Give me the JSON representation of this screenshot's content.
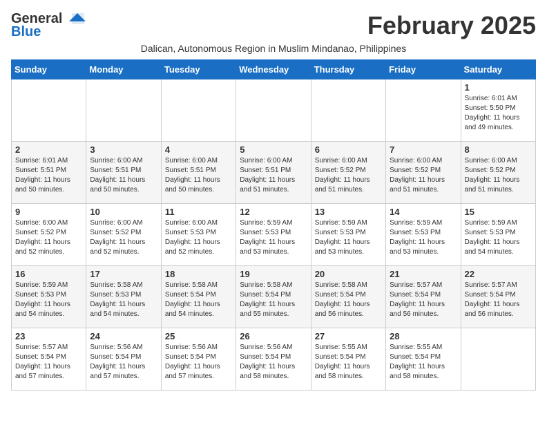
{
  "header": {
    "logo_general": "General",
    "logo_blue": "Blue",
    "month_title": "February 2025",
    "location": "Dalican, Autonomous Region in Muslim Mindanao, Philippines"
  },
  "days_of_week": [
    "Sunday",
    "Monday",
    "Tuesday",
    "Wednesday",
    "Thursday",
    "Friday",
    "Saturday"
  ],
  "weeks": [
    [
      {
        "day": "",
        "info": ""
      },
      {
        "day": "",
        "info": ""
      },
      {
        "day": "",
        "info": ""
      },
      {
        "day": "",
        "info": ""
      },
      {
        "day": "",
        "info": ""
      },
      {
        "day": "",
        "info": ""
      },
      {
        "day": "1",
        "info": "Sunrise: 6:01 AM\nSunset: 5:50 PM\nDaylight: 11 hours\nand 49 minutes."
      }
    ],
    [
      {
        "day": "2",
        "info": "Sunrise: 6:01 AM\nSunset: 5:51 PM\nDaylight: 11 hours\nand 50 minutes."
      },
      {
        "day": "3",
        "info": "Sunrise: 6:00 AM\nSunset: 5:51 PM\nDaylight: 11 hours\nand 50 minutes."
      },
      {
        "day": "4",
        "info": "Sunrise: 6:00 AM\nSunset: 5:51 PM\nDaylight: 11 hours\nand 50 minutes."
      },
      {
        "day": "5",
        "info": "Sunrise: 6:00 AM\nSunset: 5:51 PM\nDaylight: 11 hours\nand 51 minutes."
      },
      {
        "day": "6",
        "info": "Sunrise: 6:00 AM\nSunset: 5:52 PM\nDaylight: 11 hours\nand 51 minutes."
      },
      {
        "day": "7",
        "info": "Sunrise: 6:00 AM\nSunset: 5:52 PM\nDaylight: 11 hours\nand 51 minutes."
      },
      {
        "day": "8",
        "info": "Sunrise: 6:00 AM\nSunset: 5:52 PM\nDaylight: 11 hours\nand 51 minutes."
      }
    ],
    [
      {
        "day": "9",
        "info": "Sunrise: 6:00 AM\nSunset: 5:52 PM\nDaylight: 11 hours\nand 52 minutes."
      },
      {
        "day": "10",
        "info": "Sunrise: 6:00 AM\nSunset: 5:52 PM\nDaylight: 11 hours\nand 52 minutes."
      },
      {
        "day": "11",
        "info": "Sunrise: 6:00 AM\nSunset: 5:53 PM\nDaylight: 11 hours\nand 52 minutes."
      },
      {
        "day": "12",
        "info": "Sunrise: 5:59 AM\nSunset: 5:53 PM\nDaylight: 11 hours\nand 53 minutes."
      },
      {
        "day": "13",
        "info": "Sunrise: 5:59 AM\nSunset: 5:53 PM\nDaylight: 11 hours\nand 53 minutes."
      },
      {
        "day": "14",
        "info": "Sunrise: 5:59 AM\nSunset: 5:53 PM\nDaylight: 11 hours\nand 53 minutes."
      },
      {
        "day": "15",
        "info": "Sunrise: 5:59 AM\nSunset: 5:53 PM\nDaylight: 11 hours\nand 54 minutes."
      }
    ],
    [
      {
        "day": "16",
        "info": "Sunrise: 5:59 AM\nSunset: 5:53 PM\nDaylight: 11 hours\nand 54 minutes."
      },
      {
        "day": "17",
        "info": "Sunrise: 5:58 AM\nSunset: 5:53 PM\nDaylight: 11 hours\nand 54 minutes."
      },
      {
        "day": "18",
        "info": "Sunrise: 5:58 AM\nSunset: 5:54 PM\nDaylight: 11 hours\nand 54 minutes."
      },
      {
        "day": "19",
        "info": "Sunrise: 5:58 AM\nSunset: 5:54 PM\nDaylight: 11 hours\nand 55 minutes."
      },
      {
        "day": "20",
        "info": "Sunrise: 5:58 AM\nSunset: 5:54 PM\nDaylight: 11 hours\nand 56 minutes."
      },
      {
        "day": "21",
        "info": "Sunrise: 5:57 AM\nSunset: 5:54 PM\nDaylight: 11 hours\nand 56 minutes."
      },
      {
        "day": "22",
        "info": "Sunrise: 5:57 AM\nSunset: 5:54 PM\nDaylight: 11 hours\nand 56 minutes."
      }
    ],
    [
      {
        "day": "23",
        "info": "Sunrise: 5:57 AM\nSunset: 5:54 PM\nDaylight: 11 hours\nand 57 minutes."
      },
      {
        "day": "24",
        "info": "Sunrise: 5:56 AM\nSunset: 5:54 PM\nDaylight: 11 hours\nand 57 minutes."
      },
      {
        "day": "25",
        "info": "Sunrise: 5:56 AM\nSunset: 5:54 PM\nDaylight: 11 hours\nand 57 minutes."
      },
      {
        "day": "26",
        "info": "Sunrise: 5:56 AM\nSunset: 5:54 PM\nDaylight: 11 hours\nand 58 minutes."
      },
      {
        "day": "27",
        "info": "Sunrise: 5:55 AM\nSunset: 5:54 PM\nDaylight: 11 hours\nand 58 minutes."
      },
      {
        "day": "28",
        "info": "Sunrise: 5:55 AM\nSunset: 5:54 PM\nDaylight: 11 hours\nand 58 minutes."
      },
      {
        "day": "",
        "info": ""
      }
    ]
  ]
}
